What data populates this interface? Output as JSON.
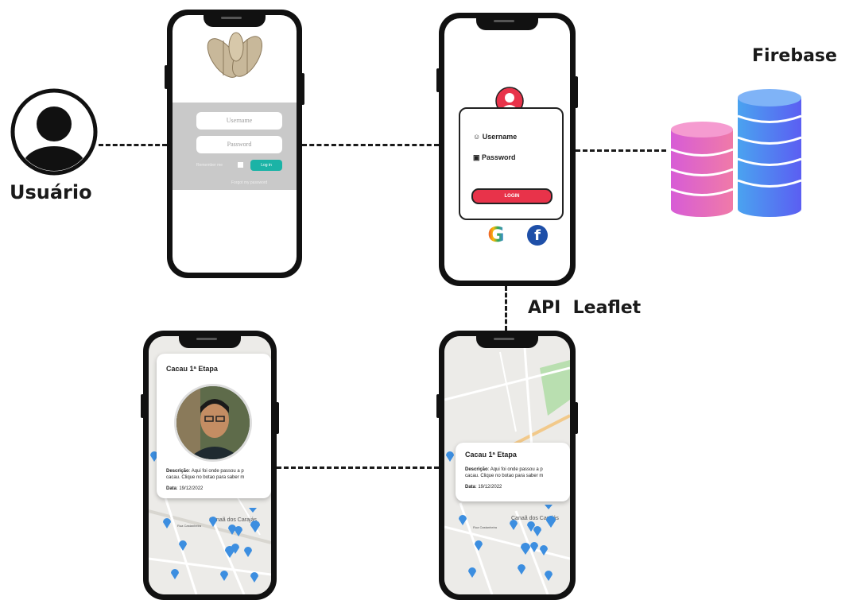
{
  "labels": {
    "user": "Usuário",
    "firebase": "Firebase",
    "api": "API  Leaflet"
  },
  "phone1": {
    "username_placeholder": "Username",
    "password_placeholder": "Password",
    "remember": "Remember me",
    "login_button": "Log in",
    "forgot": "Forgot my password"
  },
  "phone2": {
    "username_label": "Username",
    "password_label": "Password",
    "login_button": "LOGIN",
    "google_letter": "G",
    "facebook_letter": "f"
  },
  "popup_left": {
    "title": "Cacau 1ª Etapa",
    "desc_label": "Descrição",
    "desc_line1": ": Aqui foi onde passou a p",
    "desc_line2": "cacau. Clique no botao para saber m",
    "date_label": "Data",
    "date_value": ": 19/12/2022",
    "map_place": "Canaã dos Carajás",
    "map_street": "Rua Castanheira"
  },
  "popup_right": {
    "title": "Cacau 1ª Etapa",
    "desc_label": "Descrição",
    "desc_line1": ": Aqui foi onde passou a p",
    "desc_line2": "cacau. Clique no botao para saber m",
    "date_label": "Data",
    "date_value": ": 19/12/2022",
    "map_place": "Canaã dos Carajás",
    "map_street": "Rua Castanheira"
  },
  "colors": {
    "accent_red": "#e8334a",
    "teal": "#1bb3a6",
    "pin_blue": "#3c8ee0",
    "db_blue": "#4a7cf0",
    "db_pink": "#e26bd6"
  },
  "icons": [
    "user-avatar-icon",
    "database-icon",
    "cacao-logo-icon",
    "google-icon",
    "facebook-icon",
    "map-pin-icon"
  ]
}
